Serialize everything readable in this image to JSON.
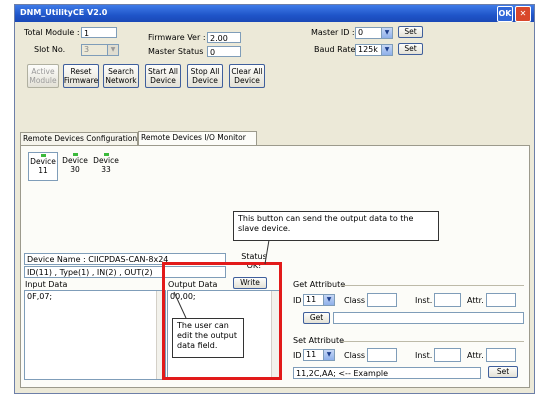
{
  "window": {
    "title": "DNM_UtilityCE V2.0",
    "ok_label": "OK",
    "close_label": "✕"
  },
  "top": {
    "total_module_label": "Total Module :",
    "total_module_value": "1",
    "slot_no_label": "Slot No.",
    "slot_no_value": "3",
    "firmware_label": "Firmware Ver :",
    "firmware_value": "2.00",
    "master_status_label": "Master Status",
    "master_status_value": "0",
    "master_id_label": "Master ID :",
    "master_id_value": "0",
    "baud_rate_label": "Baud Rate",
    "baud_rate_value": "125k",
    "set_label": "Set"
  },
  "buttons": [
    {
      "l1": "Active",
      "l2": "Module"
    },
    {
      "l1": "Reset",
      "l2": "Firmware"
    },
    {
      "l1": "Search",
      "l2": "Network"
    },
    {
      "l1": "Start All",
      "l2": "Device"
    },
    {
      "l1": "Stop All",
      "l2": "Device"
    },
    {
      "l1": "Clear All",
      "l2": "Device"
    }
  ],
  "tabs": [
    "Remote Devices Configuration",
    "Remote Devices I/O Monitor"
  ],
  "devices": [
    {
      "name": "Device",
      "id": "11"
    },
    {
      "name": "Device",
      "id": "30"
    },
    {
      "name": "Device",
      "id": "33"
    }
  ],
  "device_info": {
    "name_line": "Device Name : CIICPDAS-CAN-8x24",
    "id_line": "ID(11) , Type(1) , IN(2) , OUT(2)",
    "status_label": "Status",
    "status_value": "OK!"
  },
  "input": {
    "label": "Input Data",
    "value": "0F,07;"
  },
  "output": {
    "label": "Output Data",
    "value": "00,00;",
    "write_label": "Write"
  },
  "get_attr": {
    "title": "Get Attribute",
    "id_label": "ID",
    "id_value": "11",
    "class_label": "Class",
    "inst_label": "Inst.",
    "attr_label": "Attr.",
    "button": "Get"
  },
  "set_attr": {
    "title": "Set Attribute",
    "id_label": "ID",
    "id_value": "11",
    "class_label": "Class",
    "inst_label": "Inst.",
    "attr_label": "Attr.",
    "value": "11,2C,AA;   <-- Example",
    "button": "Set"
  },
  "callouts": {
    "write_note": "This button can send the output data to the slave device.",
    "edit_note": "The user can edit the output data field."
  },
  "colors": {
    "highlight": "#e21a1a",
    "status_led": "#3cba3c",
    "titlebar": "#1f55c9"
  }
}
